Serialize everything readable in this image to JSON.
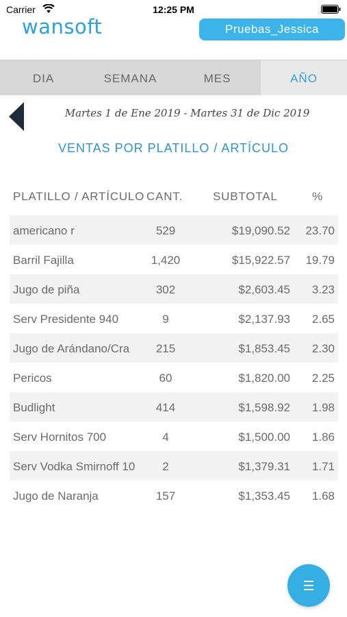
{
  "status_bar": {
    "carrier": "Carrier",
    "time": "12:25 PM"
  },
  "header": {
    "logo": "wansoft",
    "user": "Pruebas_Jessica"
  },
  "tabs": [
    {
      "label": "DIA",
      "active": false
    },
    {
      "label": "SEMANA",
      "active": false
    },
    {
      "label": "MES",
      "active": false
    },
    {
      "label": "AÑO",
      "active": true
    }
  ],
  "date_range": "Martes 1 de Ene 2019  -  Martes 31 de Dic 2019",
  "report_title": "VENTAS POR PLATILLO / ARTÍCULO",
  "table": {
    "columns": [
      "PLATILLO / ARTÍCULO",
      "CANT.",
      "SUBTOTAL",
      "%"
    ],
    "rows": [
      {
        "name": "americano r",
        "qty": "529",
        "subtotal": "$19,090.52",
        "pct": "23.70"
      },
      {
        "name": "Barril Fajilla",
        "qty": "1,420",
        "subtotal": "$15,922.57",
        "pct": "19.79"
      },
      {
        "name": "Jugo de piña",
        "qty": "302",
        "subtotal": "$2,603.45",
        "pct": "3.23"
      },
      {
        "name": "Serv Presidente 940",
        "qty": "9",
        "subtotal": "$2,137.93",
        "pct": "2.65"
      },
      {
        "name": "Jugo de Arándano/Cra",
        "qty": "215",
        "subtotal": "$1,853.45",
        "pct": "2.30"
      },
      {
        "name": "Pericos",
        "qty": "60",
        "subtotal": "$1,820.00",
        "pct": "2.25"
      },
      {
        "name": "Budlight",
        "qty": "414",
        "subtotal": "$1,598.92",
        "pct": "1.98"
      },
      {
        "name": "Serv Hornitos 700",
        "qty": "4",
        "subtotal": "$1,500.00",
        "pct": "1.86"
      },
      {
        "name": "Serv Vodka Smirnoff 10",
        "qty": "2",
        "subtotal": "$1,379.31",
        "pct": "1.71"
      },
      {
        "name": "Jugo de Naranja",
        "qty": "157",
        "subtotal": "$1,353.45",
        "pct": "1.68"
      }
    ]
  },
  "fab": {
    "icon": "menu-icon"
  },
  "colors": {
    "accent": "#3cb4e9",
    "title": "#2f95cf",
    "tab_bar": "#d8d8d8",
    "row_alt": "#f3f3f3",
    "dark_arrow": "#1f2a3a"
  }
}
